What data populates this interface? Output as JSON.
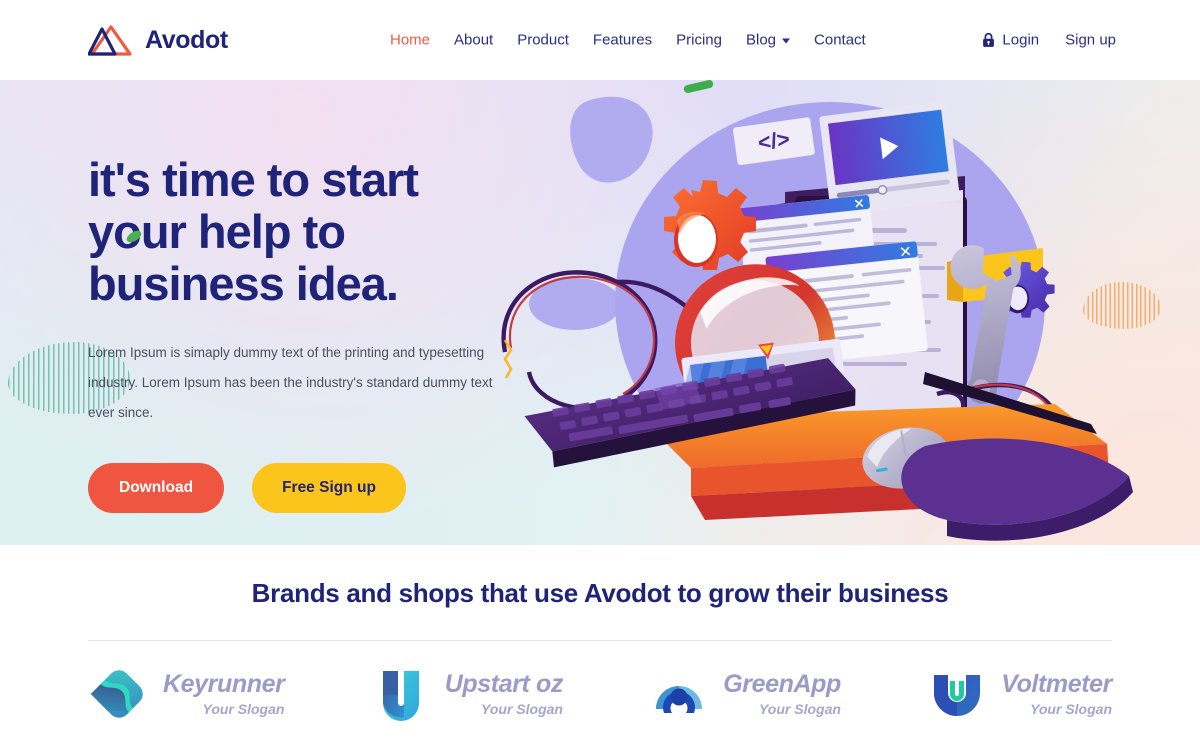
{
  "header": {
    "brand_name": "Avodot",
    "logo_icon": "avodot-triangle-logo",
    "nav": [
      {
        "label": "Home",
        "active": true
      },
      {
        "label": "About",
        "active": false
      },
      {
        "label": "Product",
        "active": false
      },
      {
        "label": "Features",
        "active": false
      },
      {
        "label": "Pricing",
        "active": false
      },
      {
        "label": "Blog",
        "active": false,
        "has_dropdown": true
      },
      {
        "label": "Contact",
        "active": false
      }
    ],
    "auth": {
      "login_label": "Login",
      "login_icon": "lock-icon",
      "signup_label": "Sign up"
    }
  },
  "hero": {
    "title_line1": "it's time to start",
    "title_line2": "your help to",
    "title_line3": "business idea.",
    "paragraph": "Lorem Ipsum is simaply dummy text of the printing and typesetting industry. Lorem Ipsum has been the industry's standard dummy text ever since.",
    "buttons": {
      "download_label": "Download",
      "signup_label": "Free Sign up"
    },
    "illustration_name": "desktop-computer-seo-illustration"
  },
  "brands": {
    "title": "Brands and shops that use Avodot to grow their business",
    "slogan_text": "Your Slogan",
    "items": [
      {
        "name": "Keyrunner",
        "slogan": "Your Slogan",
        "icon": "keyrunner-diamond-logo"
      },
      {
        "name": "Upstart oz",
        "slogan": "Your Slogan",
        "icon": "upstart-u-logo"
      },
      {
        "name": "GreenApp",
        "slogan": "Your Slogan",
        "icon": "greenapp-arc-logo"
      },
      {
        "name": "Voltmeter",
        "slogan": "Your Slogan",
        "icon": "voltmeter-shield-logo"
      }
    ]
  },
  "colors": {
    "brand_navy": "#1F2479",
    "accent_orange": "#EF5B41",
    "button_red": "#EF5540",
    "button_yellow": "#FCC51C",
    "nav_text": "#2A2E87",
    "brand_grey": "#9B9BC9"
  }
}
